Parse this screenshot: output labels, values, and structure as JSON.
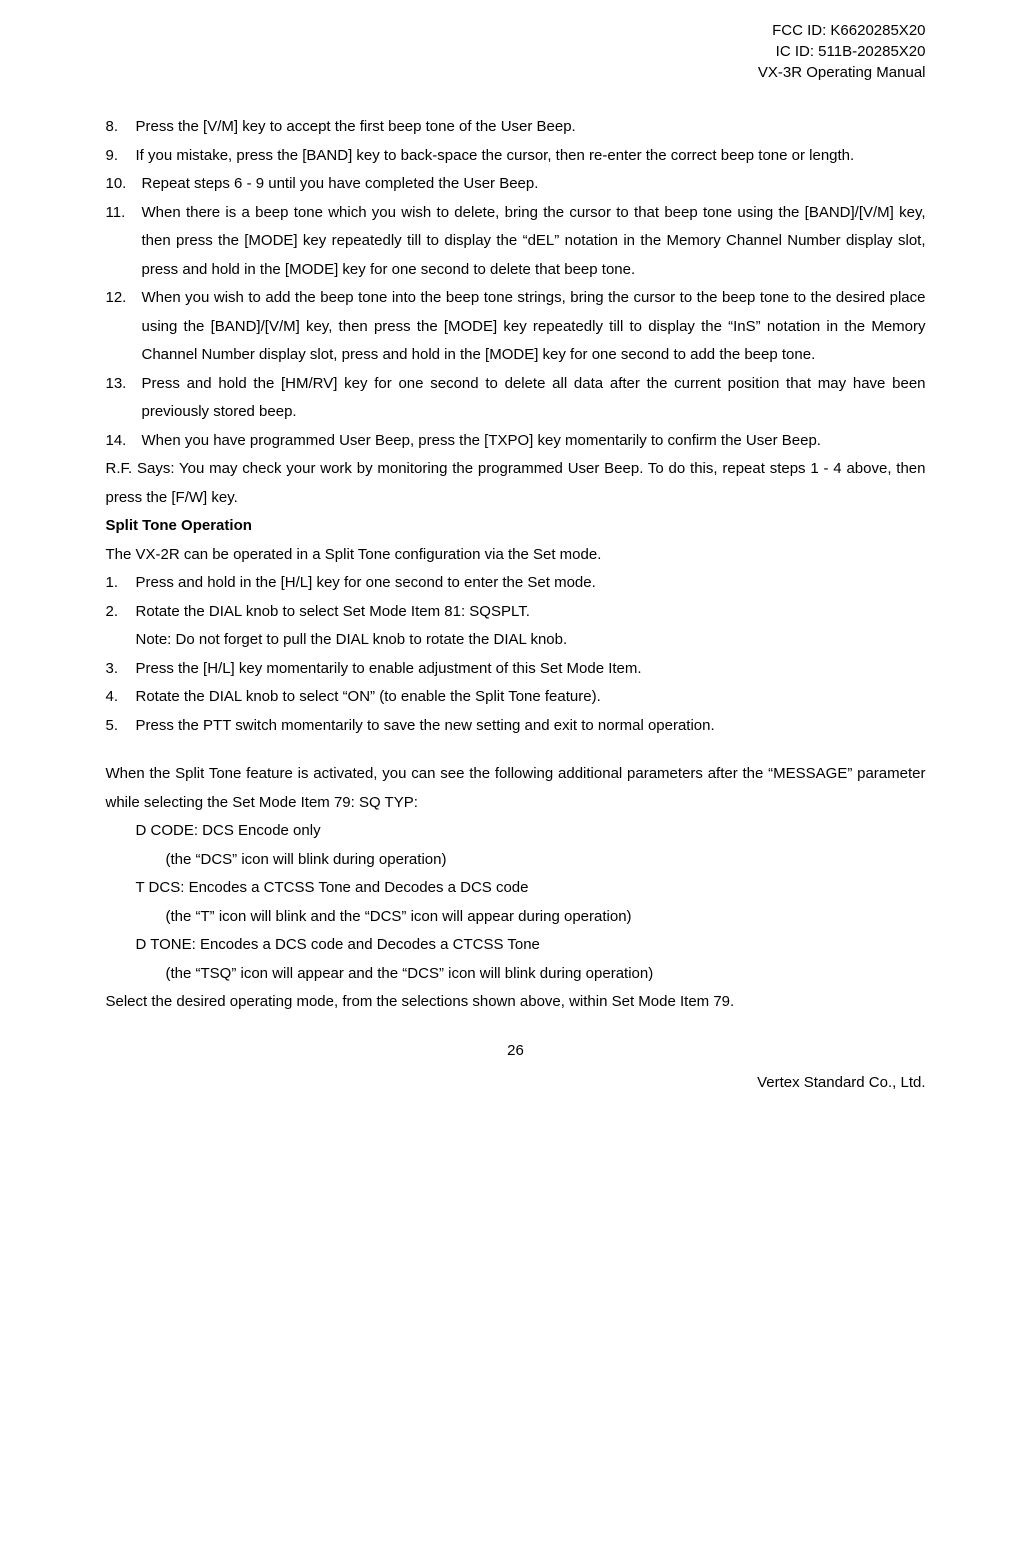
{
  "header": {
    "line1": "FCC ID: K6620285X20",
    "line2": "IC ID: 511B-20285X20",
    "line3": "VX-3R Operating Manual"
  },
  "list1": [
    {
      "num": "8.",
      "text": "Press the [V/M] key to accept the first beep tone of the User Beep."
    },
    {
      "num": "9.",
      "text": "If you mistake, press the [BAND] key to back-space the cursor, then re-enter the correct beep tone or length."
    },
    {
      "num": "10.",
      "text": "Repeat steps 6 - 9 until you have completed the User Beep."
    },
    {
      "num": "11.",
      "text": "When there is a beep tone which you wish to delete, bring the cursor to that beep tone using the [BAND]/[V/M] key, then press the [MODE] key repeatedly till to display the “dEL” notation in the Memory Channel Number display slot, press and hold in the [MODE] key for one second to delete that beep tone."
    },
    {
      "num": "12.",
      "text": "When you wish to add the beep tone into the beep tone strings, bring the cursor to the beep tone to the desired place using the [BAND]/[V/M] key, then press the [MODE] key repeatedly till to display the “InS” notation in the Memory Channel Number display slot, press and hold in the [MODE] key for one second to add the beep tone."
    },
    {
      "num": "13.",
      "text": "Press and hold the [HM/RV] key for one second to delete all data after the current position that may have been previously stored beep."
    },
    {
      "num": "14.",
      "text": "When you have programmed User Beep, press the [TXPO] key momentarily to confirm the User Beep."
    }
  ],
  "rf_says": "R.F. Says: You may check your work by monitoring the programmed User Beep. To do this, repeat steps 1 - 4 above, then press the [F/W] key.",
  "section_title": "Split Tone Operation",
  "split_intro": "The VX-2R can be operated in a Split Tone configuration via the Set mode.",
  "list2": [
    {
      "num": "1.",
      "text": "Press and hold in the [H/L] key for one second to enter the Set mode."
    },
    {
      "num": "2.",
      "text": "Rotate the DIAL knob to select Set Mode Item 81: SQSPLT.",
      "note": "Note: Do not forget to pull the DIAL knob to rotate the DIAL knob."
    },
    {
      "num": "3.",
      "text": "Press the [H/L] key momentarily to enable adjustment of this Set Mode Item."
    },
    {
      "num": "4.",
      "text": "Rotate the DIAL knob to select “ON” (to enable the Split Tone feature)."
    },
    {
      "num": "5.",
      "text": "Press the PTT switch momentarily to save the new setting and exit to normal operation."
    }
  ],
  "split_para": "When the Split Tone feature is activated, you can see the following additional parameters after the “MESSAGE” parameter while selecting the Set Mode Item 79: SQ TYP:",
  "params": [
    {
      "main": "D CODE: DCS Encode only",
      "sub": "(the “DCS” icon will blink during operation)"
    },
    {
      "main": "T DCS: Encodes a CTCSS Tone and Decodes a DCS code",
      "sub": "(the “T” icon will blink and the “DCS” icon will appear during operation)"
    },
    {
      "main": "D TONE: Encodes a DCS code and Decodes a CTCSS Tone",
      "sub": "(the “TSQ” icon will appear and the “DCS” icon will blink during operation)"
    }
  ],
  "select_line": "Select the desired operating mode, from the selections shown above, within Set Mode Item 79.",
  "footer": {
    "page_number": "26",
    "company": "Vertex Standard Co., Ltd."
  }
}
